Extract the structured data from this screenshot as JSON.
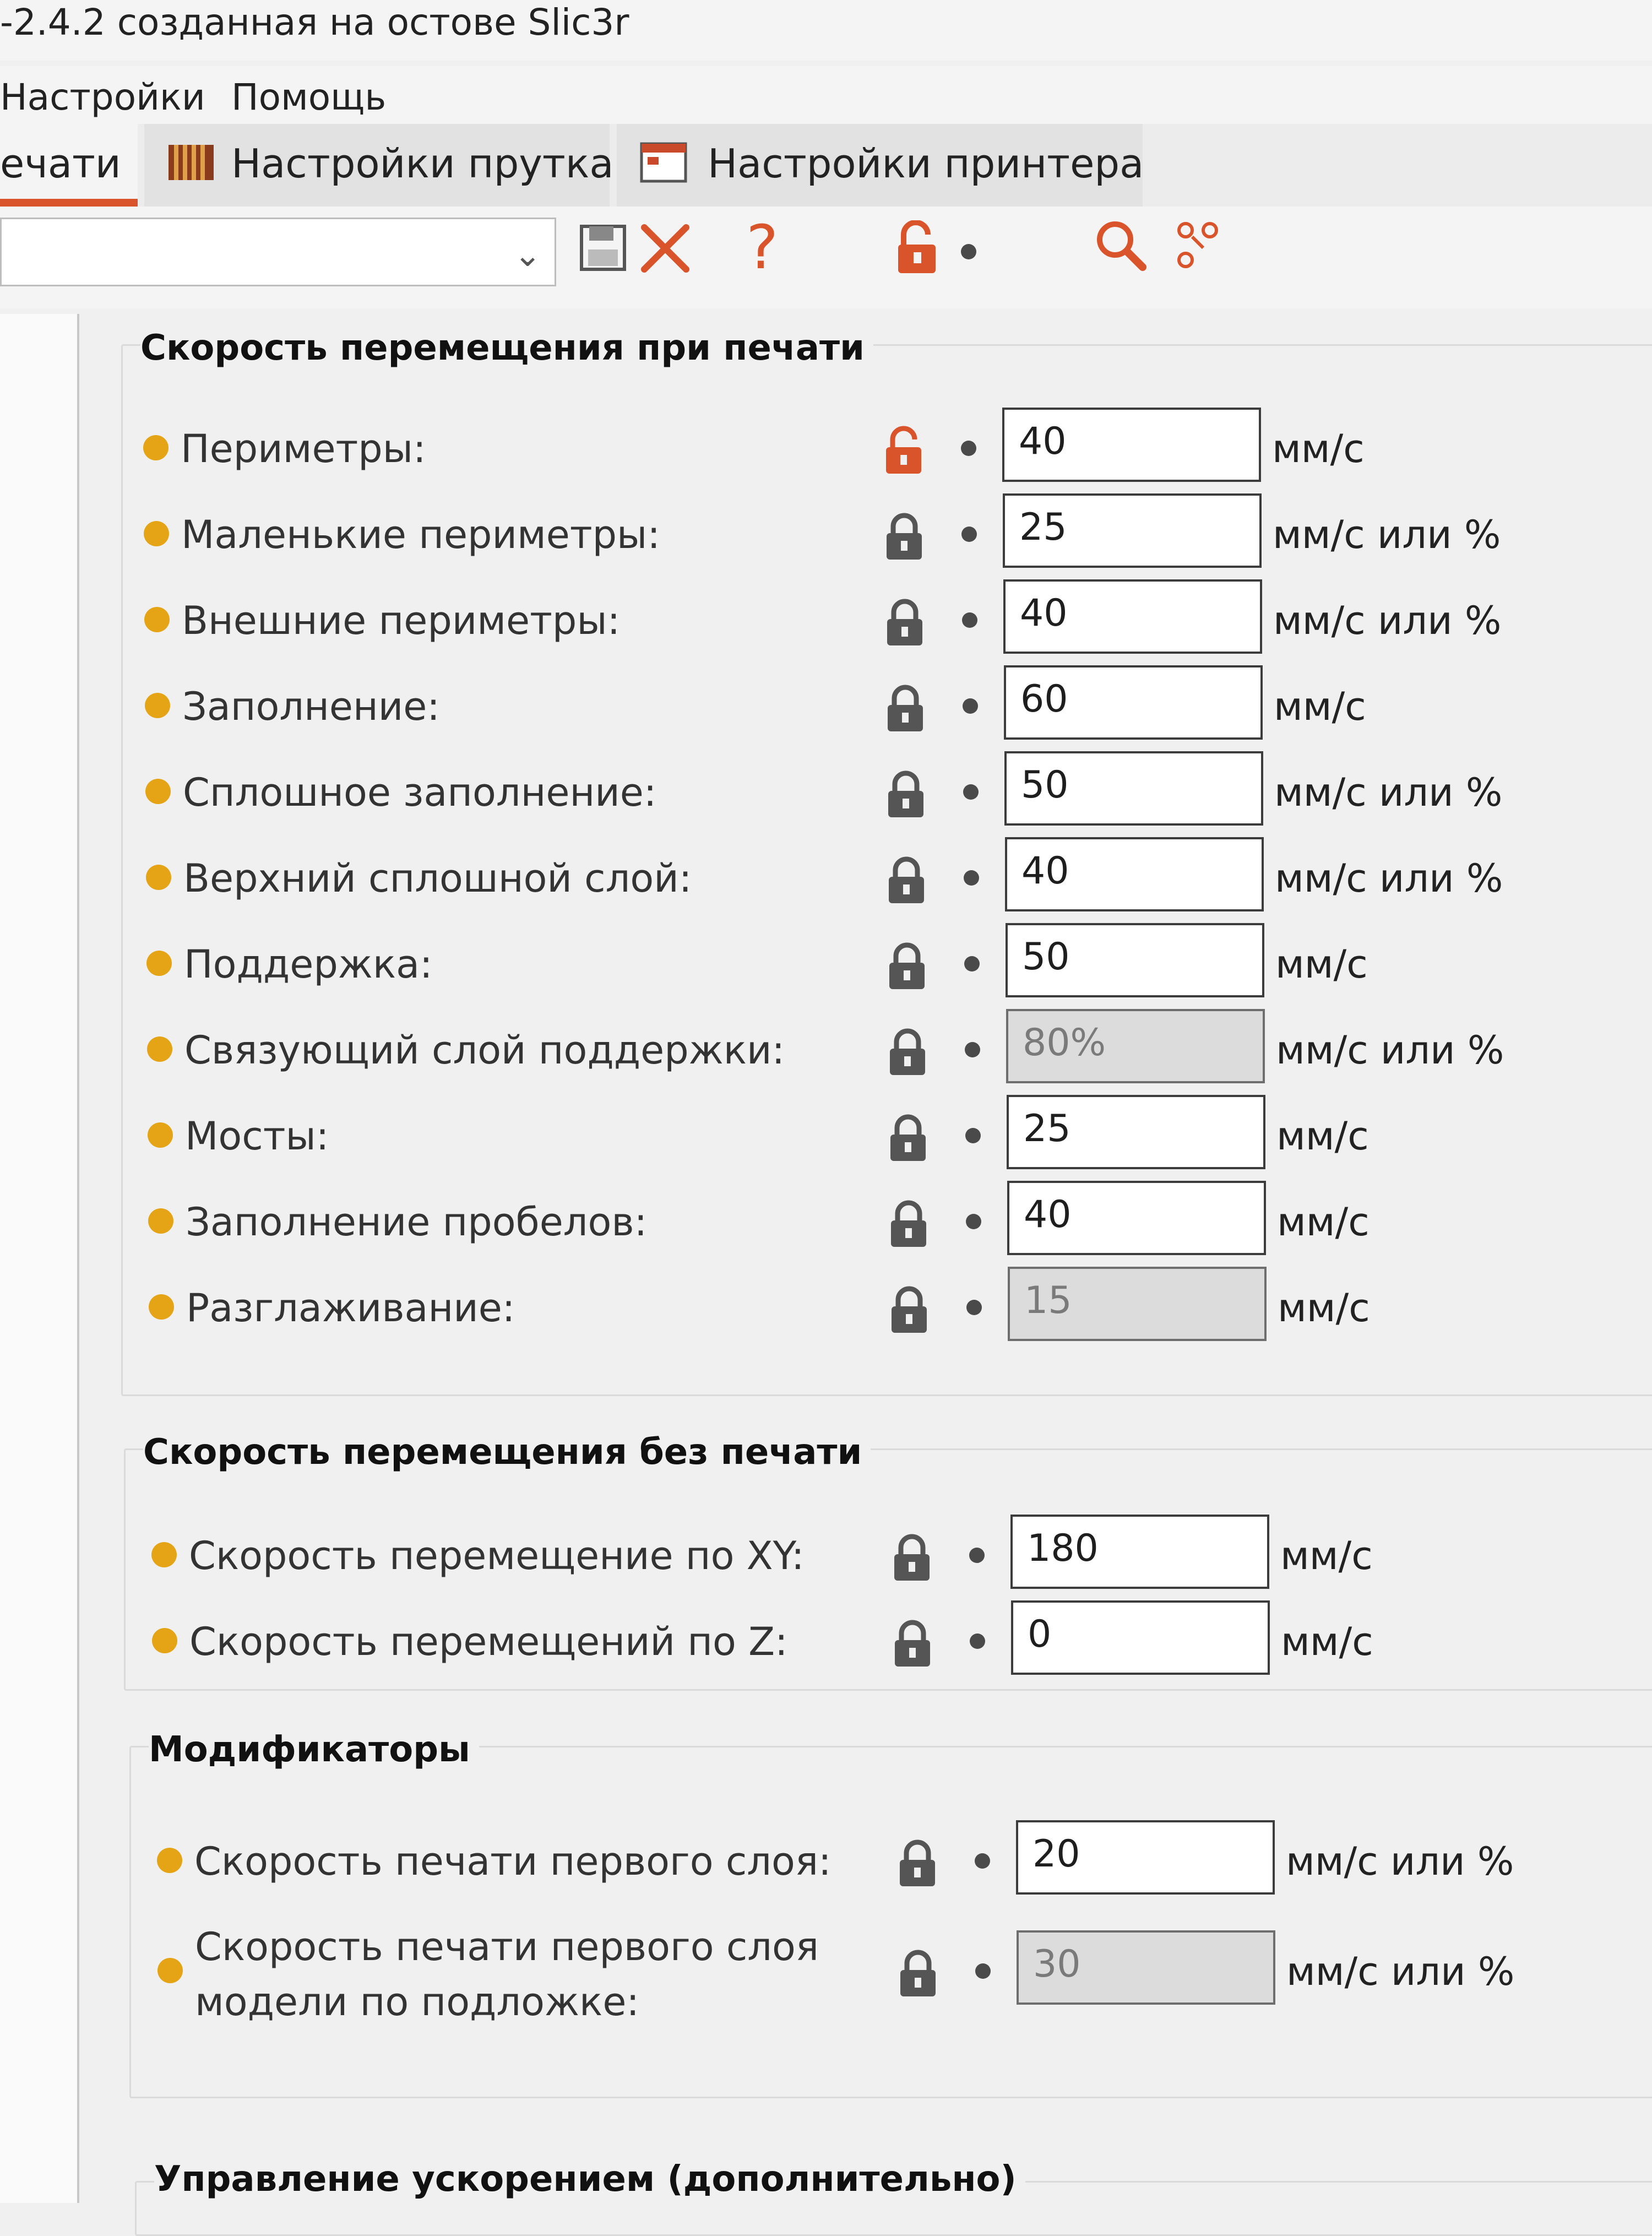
{
  "window": {
    "title": "-2.4.2 созданная на остове Slic3r"
  },
  "menu": {
    "items": [
      "Настройки",
      "Помощь"
    ]
  },
  "tabs": [
    {
      "label": "ечати",
      "icon": "print-settings-icon"
    },
    {
      "label": "Настройки прутка",
      "icon": "filament-icon"
    },
    {
      "label": "Настройки принтера",
      "icon": "printer-icon"
    }
  ],
  "toolbar": {
    "preset_value": "",
    "icons": [
      "save-icon",
      "delete-icon",
      "help-icon",
      "unlocked-lock-icon",
      "bullet-icon",
      "search-icon",
      "compare-icon"
    ]
  },
  "colors": {
    "accent": "#d9542b",
    "dot": "#e4a415"
  },
  "groups": [
    {
      "title": "Скорость перемещения при печати",
      "rows": [
        {
          "label": "Периметры:",
          "value": "40",
          "unit": "мм/с",
          "lock": "unlocked",
          "disabled": false
        },
        {
          "label": "Маленькие периметры:",
          "value": "25",
          "unit": "мм/с или %",
          "lock": "locked",
          "disabled": false
        },
        {
          "label": "Внешние периметры:",
          "value": "40",
          "unit": "мм/с или %",
          "lock": "locked",
          "disabled": false
        },
        {
          "label": "Заполнение:",
          "value": "60",
          "unit": "мм/с",
          "lock": "locked",
          "disabled": false
        },
        {
          "label": "Сплошное заполнение:",
          "value": "50",
          "unit": "мм/с или %",
          "lock": "locked",
          "disabled": false
        },
        {
          "label": "Верхний сплошной слой:",
          "value": "40",
          "unit": "мм/с или %",
          "lock": "locked",
          "disabled": false
        },
        {
          "label": "Поддержка:",
          "value": "50",
          "unit": "мм/с",
          "lock": "locked",
          "disabled": false
        },
        {
          "label": "Связующий слой поддержки:",
          "value": "80%",
          "unit": "мм/с или %",
          "lock": "locked",
          "disabled": true
        },
        {
          "label": "Мосты:",
          "value": "25",
          "unit": "мм/с",
          "lock": "locked",
          "disabled": false
        },
        {
          "label": "Заполнение пробелов:",
          "value": "40",
          "unit": "мм/с",
          "lock": "locked",
          "disabled": false
        },
        {
          "label": "Разглаживание:",
          "value": "15",
          "unit": "мм/с",
          "lock": "locked",
          "disabled": true
        }
      ]
    },
    {
      "title": "Скорость перемещения без печати",
      "rows": [
        {
          "label": "Скорость перемещение по XY:",
          "value": "180",
          "unit": "мм/с",
          "lock": "locked",
          "disabled": false
        },
        {
          "label": "Скорость перемещений по Z:",
          "value": "0",
          "unit": "мм/с",
          "lock": "locked",
          "disabled": false
        }
      ]
    },
    {
      "title": "Модификаторы",
      "rows": [
        {
          "label": "Скорость печати первого слоя:",
          "value": "20",
          "unit": "мм/с или %",
          "lock": "locked",
          "disabled": false
        },
        {
          "label": "Скорость печати первого слоя модели по подложке:",
          "value": "30",
          "unit": "мм/с или %",
          "lock": "locked",
          "disabled": true
        }
      ]
    },
    {
      "title": "Управление ускорением (дополнительно)",
      "rows": []
    }
  ]
}
